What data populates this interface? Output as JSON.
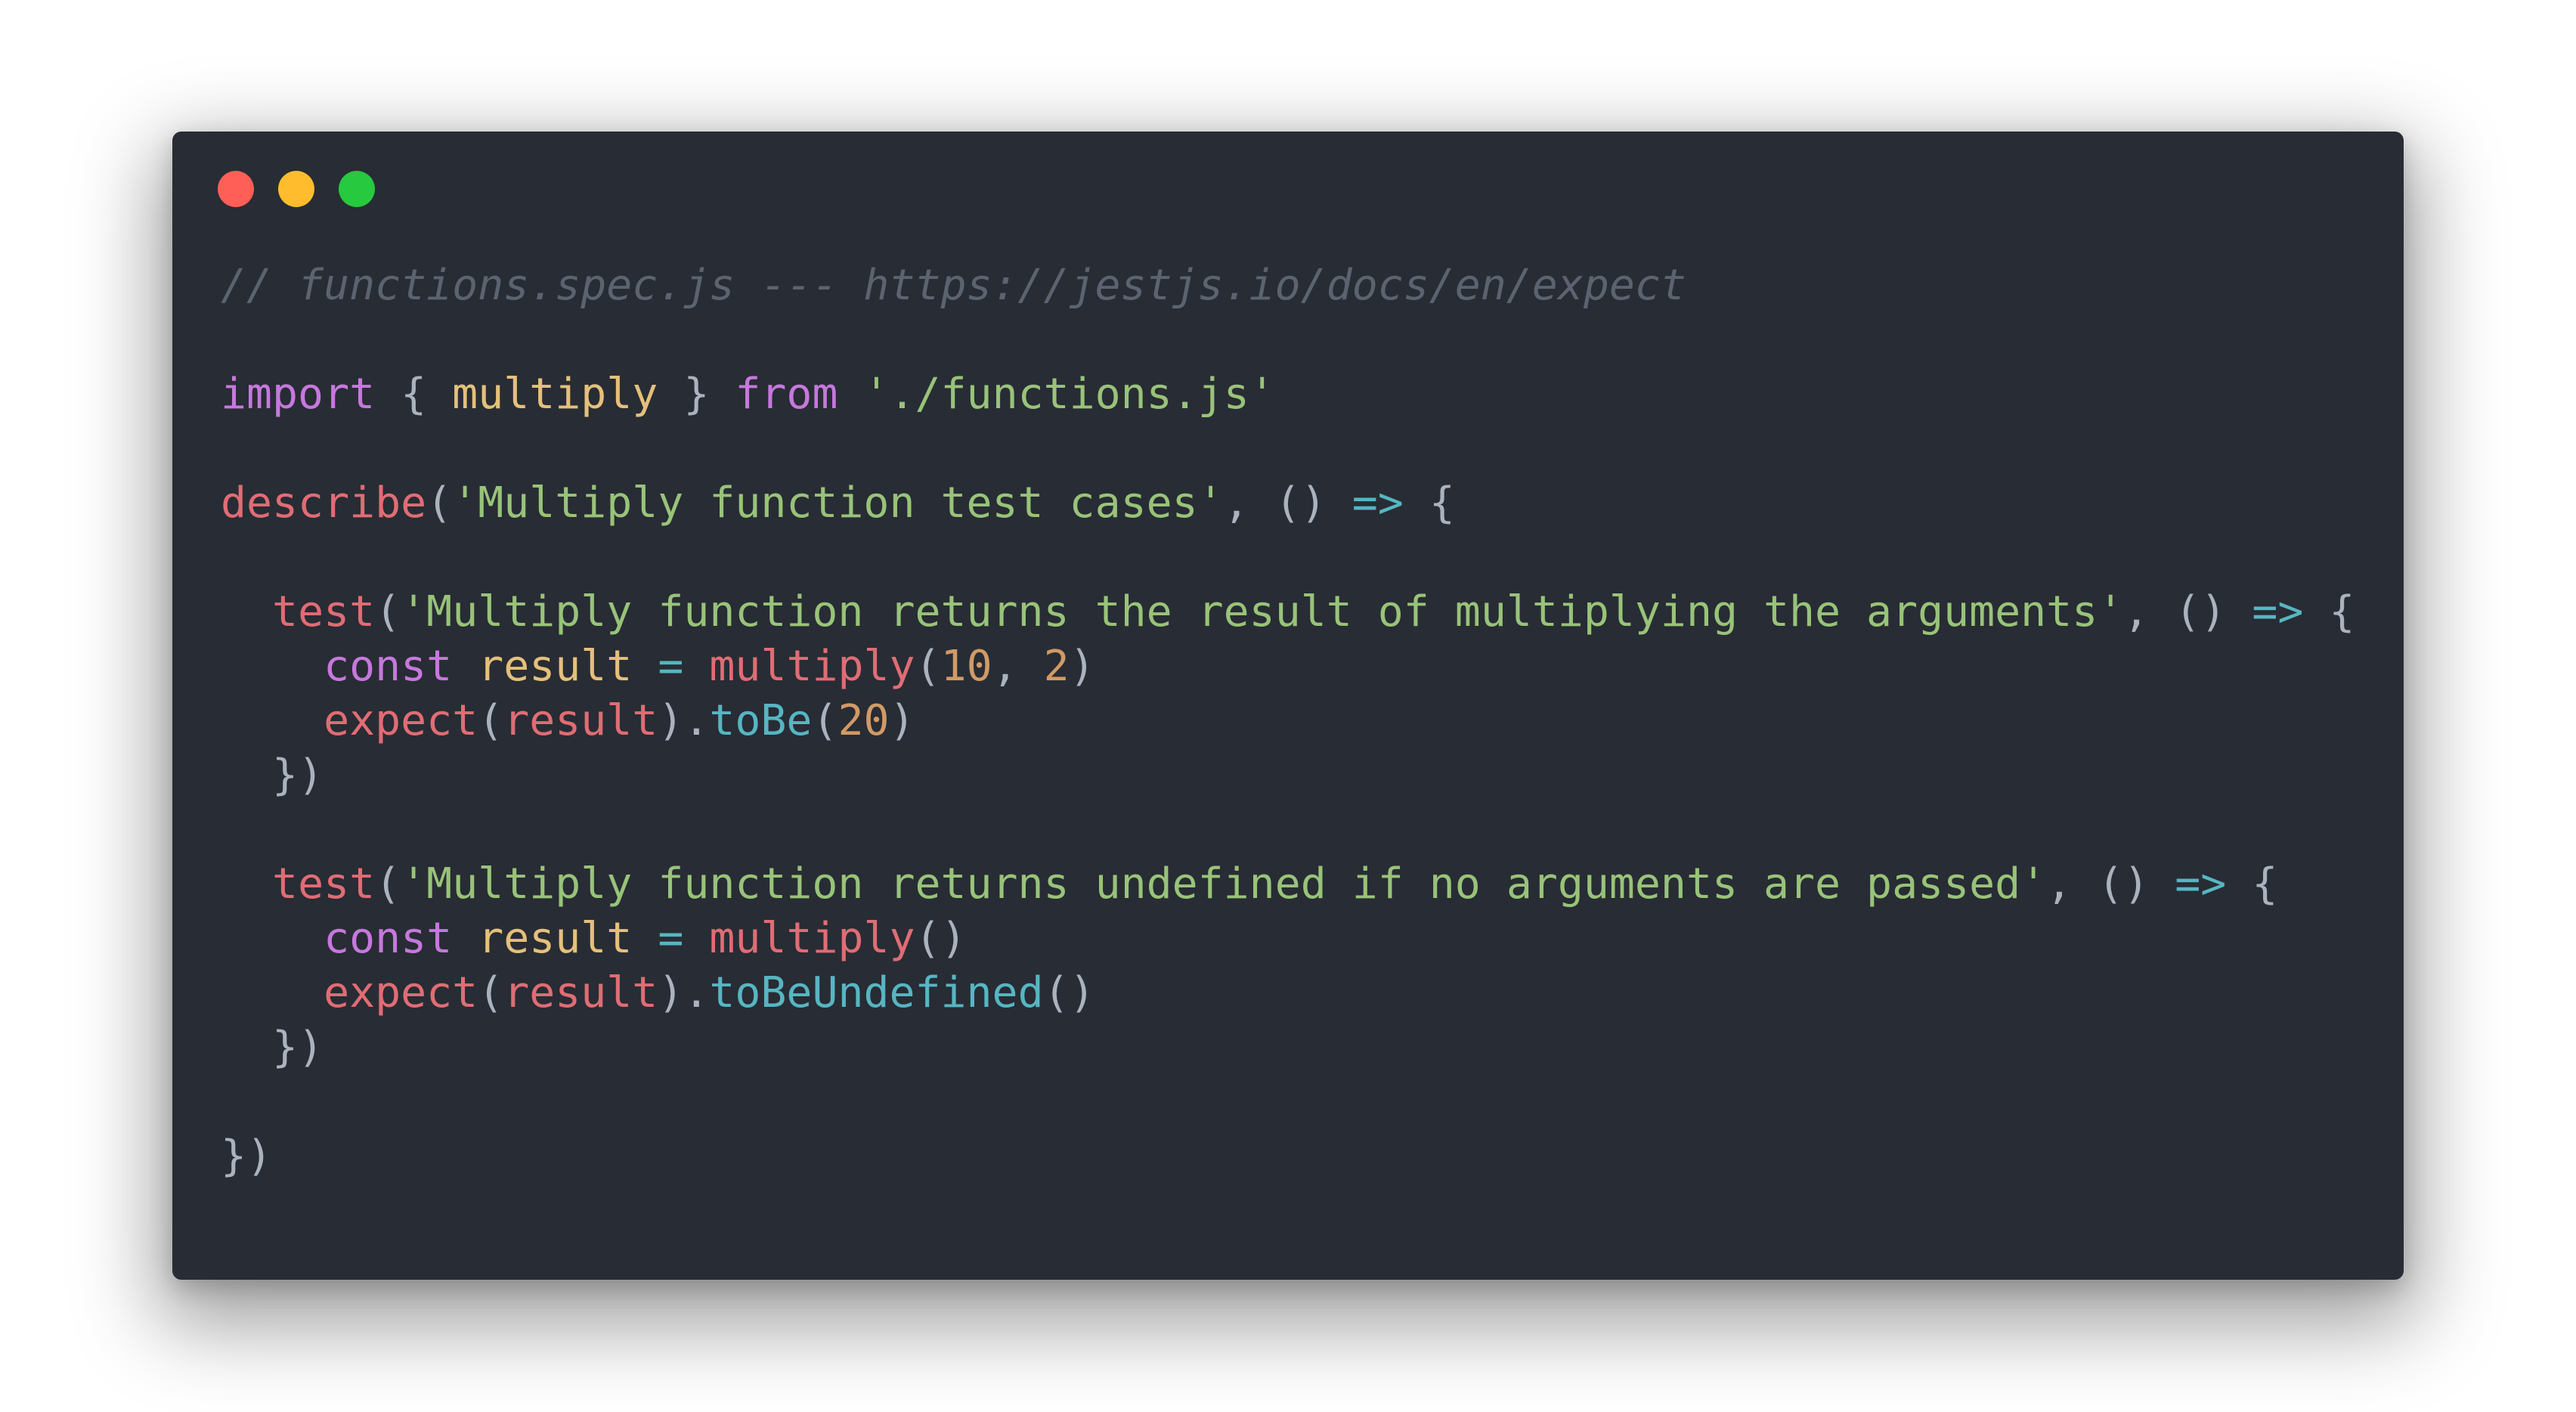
{
  "window": {
    "buttons": [
      {
        "name": "close",
        "color": "#ff5f56"
      },
      {
        "name": "minimize",
        "color": "#ffbd2e"
      },
      {
        "name": "zoom",
        "color": "#27c93f"
      }
    ],
    "background": "#282c34"
  },
  "code": {
    "lines": [
      [
        {
          "t": "comment",
          "v": "// functions.spec.js --- https://jestjs.io/docs/en/expect"
        }
      ],
      [],
      [
        {
          "t": "keyword",
          "v": "import"
        },
        {
          "t": "plain",
          "v": " { "
        },
        {
          "t": "variable",
          "v": "multiply"
        },
        {
          "t": "plain",
          "v": " } "
        },
        {
          "t": "keyword",
          "v": "from"
        },
        {
          "t": "plain",
          "v": " "
        },
        {
          "t": "string",
          "v": "'./functions.js'"
        }
      ],
      [],
      [
        {
          "t": "function",
          "v": "describe"
        },
        {
          "t": "punct",
          "v": "("
        },
        {
          "t": "string",
          "v": "'Multiply function test cases'"
        },
        {
          "t": "punct",
          "v": ", () "
        },
        {
          "t": "operator",
          "v": "=>"
        },
        {
          "t": "punct",
          "v": " {"
        }
      ],
      [],
      [
        {
          "t": "plain",
          "v": "  "
        },
        {
          "t": "function",
          "v": "test"
        },
        {
          "t": "punct",
          "v": "("
        },
        {
          "t": "string",
          "v": "'Multiply function returns the result of multiplying the arguments'"
        },
        {
          "t": "punct",
          "v": ", () "
        },
        {
          "t": "operator",
          "v": "=>"
        },
        {
          "t": "punct",
          "v": " {"
        }
      ],
      [
        {
          "t": "plain",
          "v": "    "
        },
        {
          "t": "keyword",
          "v": "const"
        },
        {
          "t": "plain",
          "v": " "
        },
        {
          "t": "variable",
          "v": "result"
        },
        {
          "t": "plain",
          "v": " "
        },
        {
          "t": "operator",
          "v": "="
        },
        {
          "t": "plain",
          "v": " "
        },
        {
          "t": "function",
          "v": "multiply"
        },
        {
          "t": "punct",
          "v": "("
        },
        {
          "t": "number",
          "v": "10"
        },
        {
          "t": "punct",
          "v": ", "
        },
        {
          "t": "number",
          "v": "2"
        },
        {
          "t": "punct",
          "v": ")"
        }
      ],
      [
        {
          "t": "plain",
          "v": "    "
        },
        {
          "t": "function",
          "v": "expect"
        },
        {
          "t": "punct",
          "v": "("
        },
        {
          "t": "ident",
          "v": "result"
        },
        {
          "t": "punct",
          "v": ")."
        },
        {
          "t": "method",
          "v": "toBe"
        },
        {
          "t": "punct",
          "v": "("
        },
        {
          "t": "number",
          "v": "20"
        },
        {
          "t": "punct",
          "v": ")"
        }
      ],
      [
        {
          "t": "punct",
          "v": "  })"
        }
      ],
      [],
      [
        {
          "t": "plain",
          "v": "  "
        },
        {
          "t": "function",
          "v": "test"
        },
        {
          "t": "punct",
          "v": "("
        },
        {
          "t": "string",
          "v": "'Multiply function returns undefined if no arguments are passed'"
        },
        {
          "t": "punct",
          "v": ", () "
        },
        {
          "t": "operator",
          "v": "=>"
        },
        {
          "t": "punct",
          "v": " {"
        }
      ],
      [
        {
          "t": "plain",
          "v": "    "
        },
        {
          "t": "keyword",
          "v": "const"
        },
        {
          "t": "plain",
          "v": " "
        },
        {
          "t": "variable",
          "v": "result"
        },
        {
          "t": "plain",
          "v": " "
        },
        {
          "t": "operator",
          "v": "="
        },
        {
          "t": "plain",
          "v": " "
        },
        {
          "t": "function",
          "v": "multiply"
        },
        {
          "t": "punct",
          "v": "()"
        }
      ],
      [
        {
          "t": "plain",
          "v": "    "
        },
        {
          "t": "function",
          "v": "expect"
        },
        {
          "t": "punct",
          "v": "("
        },
        {
          "t": "ident",
          "v": "result"
        },
        {
          "t": "punct",
          "v": ")."
        },
        {
          "t": "method",
          "v": "toBeUndefined"
        },
        {
          "t": "punct",
          "v": "()"
        }
      ],
      [
        {
          "t": "punct",
          "v": "  })"
        }
      ],
      [],
      [
        {
          "t": "punct",
          "v": "})"
        }
      ]
    ]
  }
}
